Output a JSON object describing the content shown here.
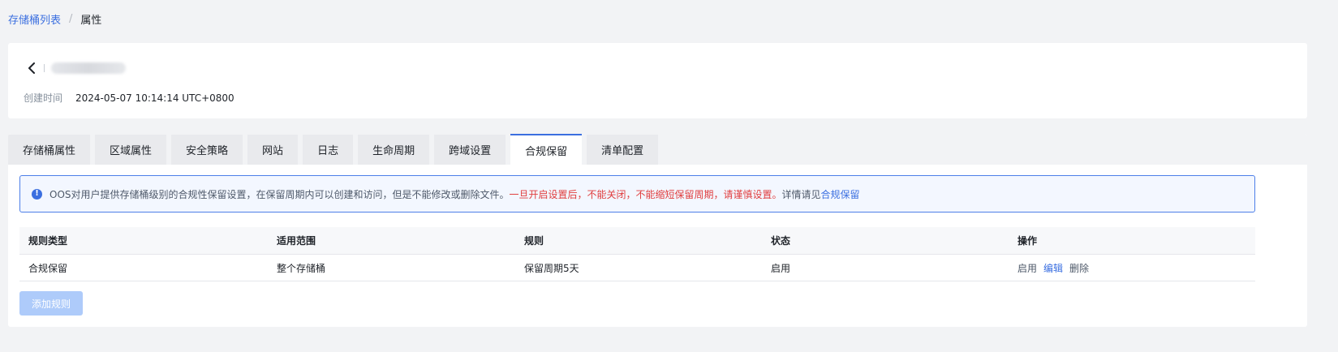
{
  "breadcrumb": {
    "parent": "存储桶列表",
    "separator": "/",
    "current": "属性"
  },
  "header": {
    "created_label": "创建时间",
    "created_value": "2024-05-07 10:14:14 UTC+0800"
  },
  "tabs": [
    {
      "label": "存储桶属性"
    },
    {
      "label": "区域属性"
    },
    {
      "label": "安全策略"
    },
    {
      "label": "网站"
    },
    {
      "label": "日志"
    },
    {
      "label": "生命周期"
    },
    {
      "label": "跨域设置"
    },
    {
      "label": "合规保留",
      "active": true
    },
    {
      "label": "清单配置"
    }
  ],
  "alert": {
    "icon": "info-icon",
    "text_normal": "OOS对用户提供存储桶级别的合规性保留设置，在保留周期内可以创建和访问，但是不能修改或删除文件。",
    "text_warn": "一旦开启设置后，不能关闭，不能缩短保留周期，请谨慎设置。",
    "text_more": "详情请见",
    "link": "合规保留"
  },
  "table": {
    "headers": [
      "规则类型",
      "适用范围",
      "规则",
      "状态",
      "操作"
    ],
    "rows": [
      {
        "type": "合规保留",
        "scope": "整个存储桶",
        "rule": "保留周期5天",
        "status": "启用",
        "actions": [
          "启用",
          "编辑",
          "删除"
        ]
      }
    ]
  },
  "add_button": "添加规则",
  "colors": {
    "accent": "#3b6fe0",
    "warning": "#e03e3e",
    "disabled_button": "#aecbfa"
  }
}
